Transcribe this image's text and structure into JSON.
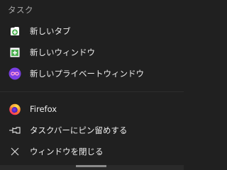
{
  "menu": {
    "section_title": "タスク",
    "items": [
      {
        "label": "新しいタブ",
        "icon": "new-tab-icon"
      },
      {
        "label": "新しいウィンドウ",
        "icon": "new-window-icon"
      },
      {
        "label": "新しいプライベートウィンドウ",
        "icon": "private-window-icon"
      },
      {
        "label": "Firefox",
        "icon": "firefox-icon"
      },
      {
        "label": "タスクバーにピン留めする",
        "icon": "pin-icon"
      },
      {
        "label": "ウィンドウを閉じる",
        "icon": "close-icon"
      }
    ]
  },
  "colors": {
    "background": "#202020",
    "text": "#f0f0f0",
    "section_title": "#a8a8a8",
    "green_accent": "#4caf50",
    "private_purple": "#7b3fe4",
    "firefox_orange": "#ff7139"
  }
}
